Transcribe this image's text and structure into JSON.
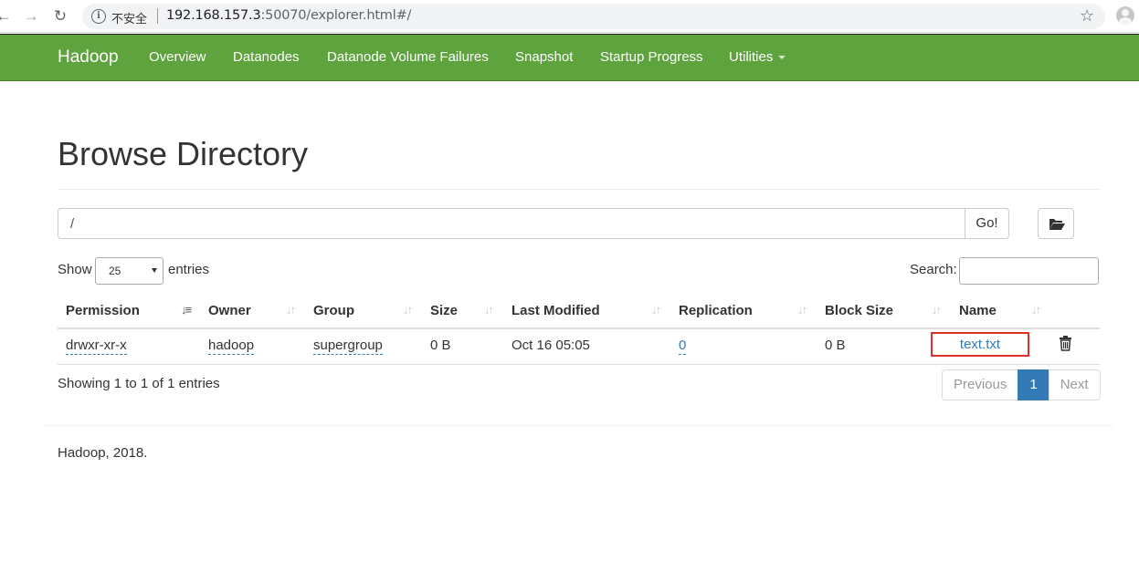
{
  "browser": {
    "security_label": "不安全",
    "url_host": "192.168.157.3",
    "url_rest": ":50070/explorer.html#/"
  },
  "navbar": {
    "brand": "Hadoop",
    "items": [
      {
        "label": "Overview"
      },
      {
        "label": "Datanodes"
      },
      {
        "label": "Datanode Volume Failures"
      },
      {
        "label": "Snapshot"
      },
      {
        "label": "Startup Progress"
      },
      {
        "label": "Utilities"
      }
    ]
  },
  "page": {
    "title": "Browse Directory",
    "path_value": "/",
    "go_label": "Go!",
    "show_label": "Show",
    "page_length": "25",
    "entries_label": "entries",
    "search_label": "Search:"
  },
  "table": {
    "columns": [
      "Permission",
      "Owner",
      "Group",
      "Size",
      "Last Modified",
      "Replication",
      "Block Size",
      "Name"
    ],
    "rows": [
      {
        "permission": "drwxr-xr-x",
        "owner": "hadoop",
        "group": "supergroup",
        "size": "0 B",
        "last_modified": "Oct 16 05:05",
        "replication": "0",
        "block_size": "0 B",
        "name": "text.txt"
      }
    ],
    "info": "Showing 1 to 1 of 1 entries"
  },
  "pagination": {
    "previous": "Previous",
    "current": "1",
    "next": "Next"
  },
  "footer": {
    "text": "Hadoop, 2018."
  },
  "colors": {
    "navbar": "#5fa33e",
    "link": "#337ab7",
    "highlight_box": "#e0302a"
  }
}
